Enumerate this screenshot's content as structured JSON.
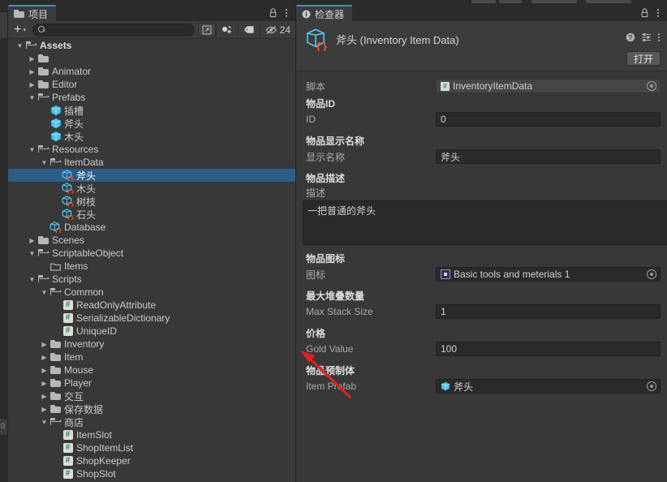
{
  "project_panel": {
    "tab_label": "项目",
    "tab_icon": "folder-icon",
    "lock_icon": "lock-icon",
    "menu_icon": "kebab-menu-icon",
    "toolbar": {
      "create_label": "+",
      "create_caret": "▾",
      "search_value": "",
      "search_placeholder": "",
      "search_icon": "search-icon",
      "save_search_icon": "save-search-icon",
      "filter_type_icon": "filter-by-type-icon",
      "filter_label_icon": "filter-by-label-icon",
      "hidden_icon": "hidden-count-icon",
      "hidden_count": "24"
    },
    "tree": [
      {
        "label": "Assets",
        "depth": 0,
        "arrow": "▼",
        "icon": "folder-open-icon",
        "bold": true,
        "selected": false
      },
      {
        "label": "",
        "depth": 1,
        "arrow": "▶",
        "icon": "folder-icon",
        "bold": false,
        "selected": false
      },
      {
        "label": "Animator",
        "depth": 1,
        "arrow": "▶",
        "icon": "folder-icon",
        "bold": false,
        "selected": false
      },
      {
        "label": "Editor",
        "depth": 1,
        "arrow": "▶",
        "icon": "folder-icon",
        "bold": false,
        "selected": false
      },
      {
        "label": "Prefabs",
        "depth": 1,
        "arrow": "▼",
        "icon": "folder-open-icon",
        "bold": false,
        "selected": false
      },
      {
        "label": "插槽",
        "depth": 2,
        "arrow": "",
        "icon": "prefab-cube-icon",
        "bold": false,
        "selected": false
      },
      {
        "label": "斧头",
        "depth": 2,
        "arrow": "",
        "icon": "prefab-cube-icon",
        "bold": false,
        "selected": false
      },
      {
        "label": "木头",
        "depth": 2,
        "arrow": "",
        "icon": "prefab-cube-icon",
        "bold": false,
        "selected": false
      },
      {
        "label": "Resources",
        "depth": 1,
        "arrow": "▼",
        "icon": "folder-open-icon",
        "bold": false,
        "selected": false
      },
      {
        "label": "ItemData",
        "depth": 2,
        "arrow": "▼",
        "icon": "folder-open-icon",
        "bold": false,
        "selected": false
      },
      {
        "label": "斧头",
        "depth": 3,
        "arrow": "",
        "icon": "scriptable-object-icon",
        "bold": false,
        "selected": true
      },
      {
        "label": "木头",
        "depth": 3,
        "arrow": "",
        "icon": "scriptable-object-icon",
        "bold": false,
        "selected": false
      },
      {
        "label": "树枝",
        "depth": 3,
        "arrow": "",
        "icon": "scriptable-object-icon",
        "bold": false,
        "selected": false
      },
      {
        "label": "石头",
        "depth": 3,
        "arrow": "",
        "icon": "scriptable-object-icon",
        "bold": false,
        "selected": false
      },
      {
        "label": "Database",
        "depth": 2,
        "arrow": "",
        "icon": "scriptable-object-icon",
        "bold": false,
        "selected": false
      },
      {
        "label": "Scenes",
        "depth": 1,
        "arrow": "▶",
        "icon": "folder-icon",
        "bold": false,
        "selected": false
      },
      {
        "label": "ScriptableObject",
        "depth": 1,
        "arrow": "▼",
        "icon": "folder-open-icon",
        "bold": false,
        "selected": false
      },
      {
        "label": "Items",
        "depth": 2,
        "arrow": "",
        "icon": "folder-empty-icon",
        "bold": false,
        "selected": false
      },
      {
        "label": "Scripts",
        "depth": 1,
        "arrow": "▼",
        "icon": "folder-open-icon",
        "bold": false,
        "selected": false
      },
      {
        "label": "Common",
        "depth": 2,
        "arrow": "▼",
        "icon": "folder-open-icon",
        "bold": false,
        "selected": false
      },
      {
        "label": "ReadOnlyAttribute",
        "depth": 3,
        "arrow": "",
        "icon": "csharp-script-icon",
        "bold": false,
        "selected": false
      },
      {
        "label": "SerializableDictionary",
        "depth": 3,
        "arrow": "",
        "icon": "csharp-script-icon",
        "bold": false,
        "selected": false
      },
      {
        "label": "UniqueID",
        "depth": 3,
        "arrow": "",
        "icon": "csharp-script-icon",
        "bold": false,
        "selected": false
      },
      {
        "label": "Inventory",
        "depth": 2,
        "arrow": "▶",
        "icon": "folder-icon",
        "bold": false,
        "selected": false
      },
      {
        "label": "Item",
        "depth": 2,
        "arrow": "▶",
        "icon": "folder-icon",
        "bold": false,
        "selected": false
      },
      {
        "label": "Mouse",
        "depth": 2,
        "arrow": "▶",
        "icon": "folder-icon",
        "bold": false,
        "selected": false
      },
      {
        "label": "Player",
        "depth": 2,
        "arrow": "▶",
        "icon": "folder-icon",
        "bold": false,
        "selected": false
      },
      {
        "label": "交互",
        "depth": 2,
        "arrow": "▶",
        "icon": "folder-icon",
        "bold": false,
        "selected": false
      },
      {
        "label": "保存数据",
        "depth": 2,
        "arrow": "▶",
        "icon": "folder-icon",
        "bold": false,
        "selected": false
      },
      {
        "label": "商店",
        "depth": 2,
        "arrow": "▼",
        "icon": "folder-open-icon",
        "bold": false,
        "selected": false
      },
      {
        "label": "ItemSlot",
        "depth": 3,
        "arrow": "",
        "icon": "csharp-script-icon",
        "bold": false,
        "selected": false
      },
      {
        "label": "ShopItemList",
        "depth": 3,
        "arrow": "",
        "icon": "csharp-script-icon",
        "bold": false,
        "selected": false
      },
      {
        "label": "ShopKeeper",
        "depth": 3,
        "arrow": "",
        "icon": "csharp-script-icon",
        "bold": false,
        "selected": false
      },
      {
        "label": "ShopSlot",
        "depth": 3,
        "arrow": "",
        "icon": "csharp-script-icon",
        "bold": false,
        "selected": false
      }
    ]
  },
  "inspector_panel": {
    "tab_label": "检查器",
    "tab_icon": "info-icon",
    "lock_icon": "lock-icon",
    "menu_icon": "kebab-menu-icon",
    "object_icon": "scriptable-object-icon",
    "object_title": "斧头 (Inventory Item Data)",
    "help_icon": "help-icon",
    "preset_icon": "preset-icon",
    "more_icon": "kebab-menu-icon",
    "open_button": "打开",
    "script_label": "脚本",
    "script_value": "InventoryItemData",
    "script_icon": "csharp-script-icon",
    "fields": [
      {
        "section": "物品ID",
        "label": "ID",
        "value": "0",
        "kind": "text"
      },
      {
        "section": "物品显示名称",
        "label": "显示名称",
        "value": "斧头",
        "kind": "text"
      },
      {
        "section": "物品描述",
        "label": "描述",
        "value": "一把普通的斧头",
        "kind": "textarea"
      },
      {
        "section": "物品图标",
        "label": "图标",
        "value": "Basic tools and meterials 1",
        "kind": "object",
        "icon": "sprite-icon"
      },
      {
        "section": "最大堆叠数量",
        "label": "Max Stack Size",
        "value": "1",
        "kind": "text"
      },
      {
        "section": "价格",
        "label": "Gold Value",
        "value": "100",
        "kind": "text"
      },
      {
        "section": "物品预制体",
        "label": "Item Prefab",
        "value": "斧头",
        "kind": "object",
        "icon": "prefab-cube-icon"
      }
    ]
  },
  "annotation": {
    "arrow_color": "#e02020",
    "arrow_name": "red-pointer-arrow",
    "points_at": "Gold Value"
  },
  "gutter": {
    "bottom_label": "0"
  },
  "colors": {
    "selection_blue": "#2c5d87",
    "tab_accent": "#4a88c7",
    "panel_bg": "#383838",
    "chrome_bg": "#2b2b2b",
    "field_bg": "#2a2a2a",
    "prefab_blue": "#4ec3ef",
    "script_green": "#2f8f46",
    "brace_orange": "#f0591e"
  }
}
